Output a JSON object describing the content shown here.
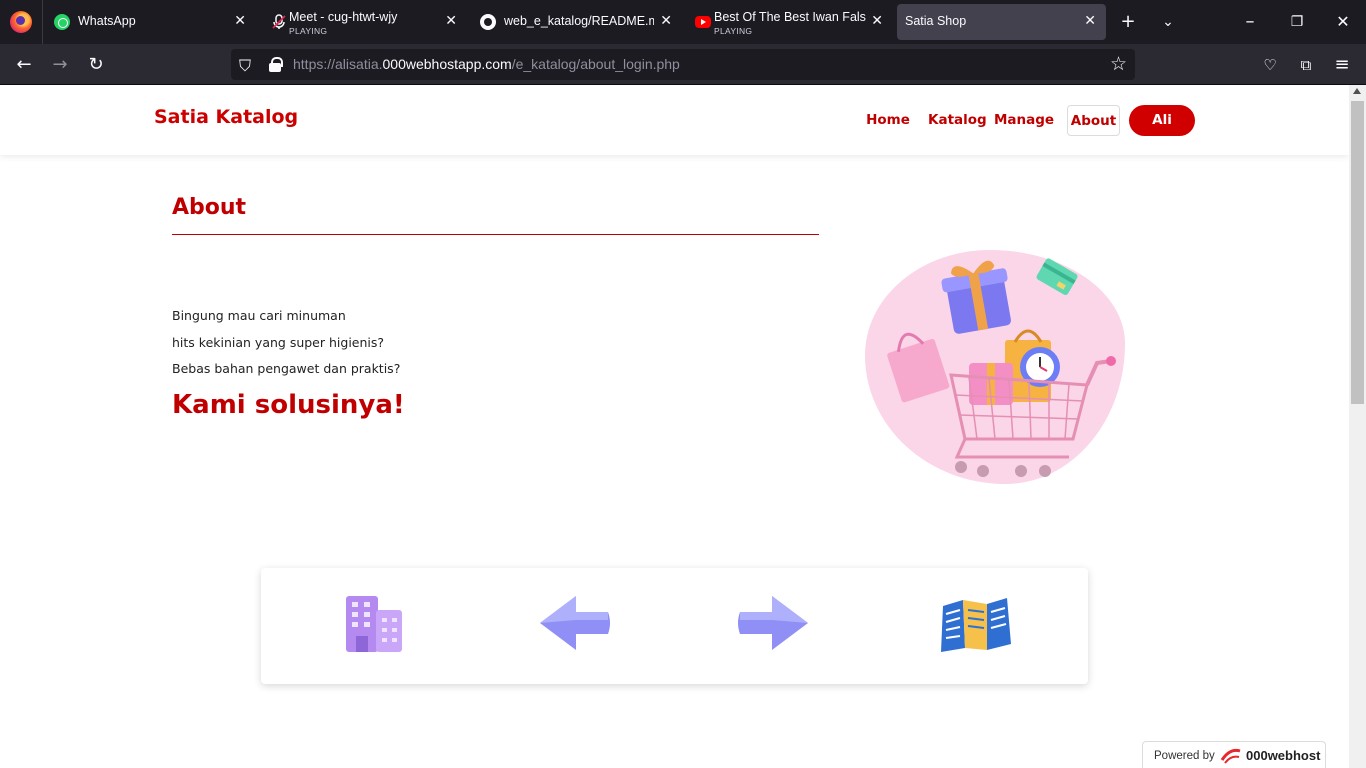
{
  "browser": {
    "tabs": [
      {
        "title": "WhatsApp",
        "sub": "",
        "icon": "whatsapp-icon"
      },
      {
        "title": "Meet - cug-htwt-wjy",
        "sub": "PLAYING",
        "icon": "microphone-muted-icon"
      },
      {
        "title": "web_e_katalog/README.md",
        "sub": "",
        "icon": "github-icon"
      },
      {
        "title": "Best Of The Best Iwan Fals ~ K",
        "sub": "PLAYING",
        "icon": "youtube-icon"
      },
      {
        "title": "Satia Shop",
        "sub": "",
        "icon": ""
      }
    ],
    "url_prefix": "https://alisatia.",
    "url_host": "000webhostapp.com",
    "url_path": "/e_katalog/about_login.php"
  },
  "site": {
    "brand": "Satia Katalog",
    "nav": {
      "home": "Home",
      "katalog": "Katalog",
      "manage": "Manage",
      "about": "About",
      "user": "Ali"
    },
    "about": {
      "title": "About",
      "lines": [
        "Bingung mau cari minuman",
        "hits kekinian yang super higienis?",
        "Bebas bahan pengawet dan praktis?"
      ],
      "headline": "Kami solusinya!"
    },
    "card_icons": [
      "building-icon",
      "arrow-left-icon",
      "arrow-right-icon",
      "brochure-icon"
    ],
    "badge": {
      "powered": "Powered by",
      "host": "000webhost"
    }
  },
  "colors": {
    "brand_red": "#c00000",
    "chrome_dark": "#1c1b22",
    "hero_blob": "#fbd5e8"
  }
}
